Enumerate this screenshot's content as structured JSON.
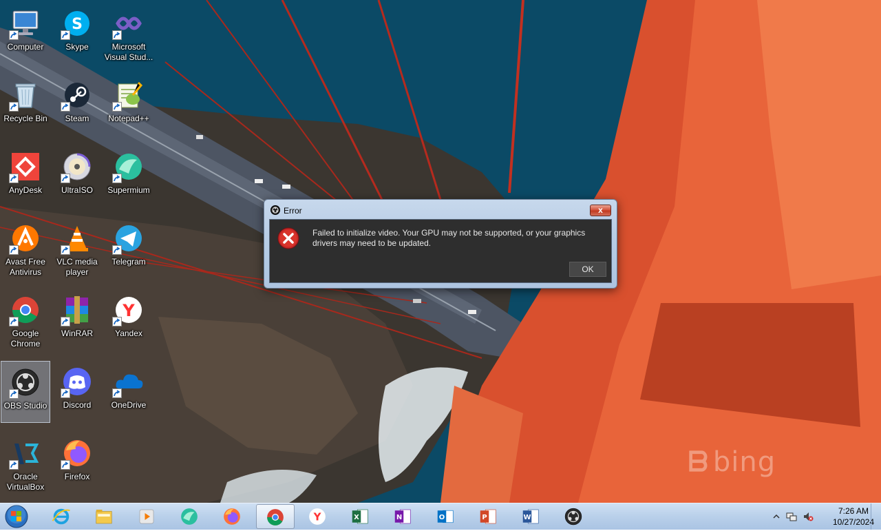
{
  "desktop": {
    "icons": [
      {
        "label": "Computer",
        "icon": "computer-icon"
      },
      {
        "label": "Skype",
        "icon": "skype-icon"
      },
      {
        "label": "Microsoft\nVisual Stud...",
        "icon": "visual-studio-icon"
      },
      {
        "label": "Recycle Bin",
        "icon": "recycle-bin-icon"
      },
      {
        "label": "Steam",
        "icon": "steam-icon"
      },
      {
        "label": "Notepad++",
        "icon": "notepad-plus-plus-icon"
      },
      {
        "label": "AnyDesk",
        "icon": "anydesk-icon"
      },
      {
        "label": "UltraISO",
        "icon": "ultraiso-icon"
      },
      {
        "label": "Supermium",
        "icon": "supermium-icon"
      },
      {
        "label": "Avast Free\nAntivirus",
        "icon": "avast-icon"
      },
      {
        "label": "VLC media\nplayer",
        "icon": "vlc-icon"
      },
      {
        "label": "Telegram",
        "icon": "telegram-icon"
      },
      {
        "label": "Google\nChrome",
        "icon": "chrome-icon"
      },
      {
        "label": "WinRAR",
        "icon": "winrar-icon"
      },
      {
        "label": "Yandex",
        "icon": "yandex-icon"
      },
      {
        "label": "OBS Studio",
        "icon": "obs-icon"
      },
      {
        "label": "Discord",
        "icon": "discord-icon"
      },
      {
        "label": "OneDrive",
        "icon": "onedrive-icon"
      },
      {
        "label": "Oracle\nVirtualBox",
        "icon": "virtualbox-icon"
      },
      {
        "label": "Firefox",
        "icon": "firefox-icon"
      }
    ],
    "selected": "OBS Studio",
    "watermark": "bing"
  },
  "dialog": {
    "title": "Error",
    "close_label": "x",
    "message": "Failed to initialize video.  Your GPU may not be supported, or your graphics drivers may need to be updated.",
    "ok_label": "OK"
  },
  "taskbar": {
    "apps": [
      "internet-explorer-icon",
      "explorer-folder-icon",
      "media-player-icon",
      "supermium-icon",
      "firefox-icon",
      "chrome-icon",
      "yandex-icon",
      "excel-icon",
      "onenote-icon",
      "outlook-icon",
      "powerpoint-icon",
      "word-icon",
      "obs-icon"
    ],
    "active_app": "chrome-icon",
    "clock": {
      "time": "7:26 AM",
      "date": "10/27/2024"
    }
  },
  "colors": {
    "dialog_client": "#2e2e2e",
    "taskbar": "#b9d0ea",
    "error_red": "#c62828"
  }
}
